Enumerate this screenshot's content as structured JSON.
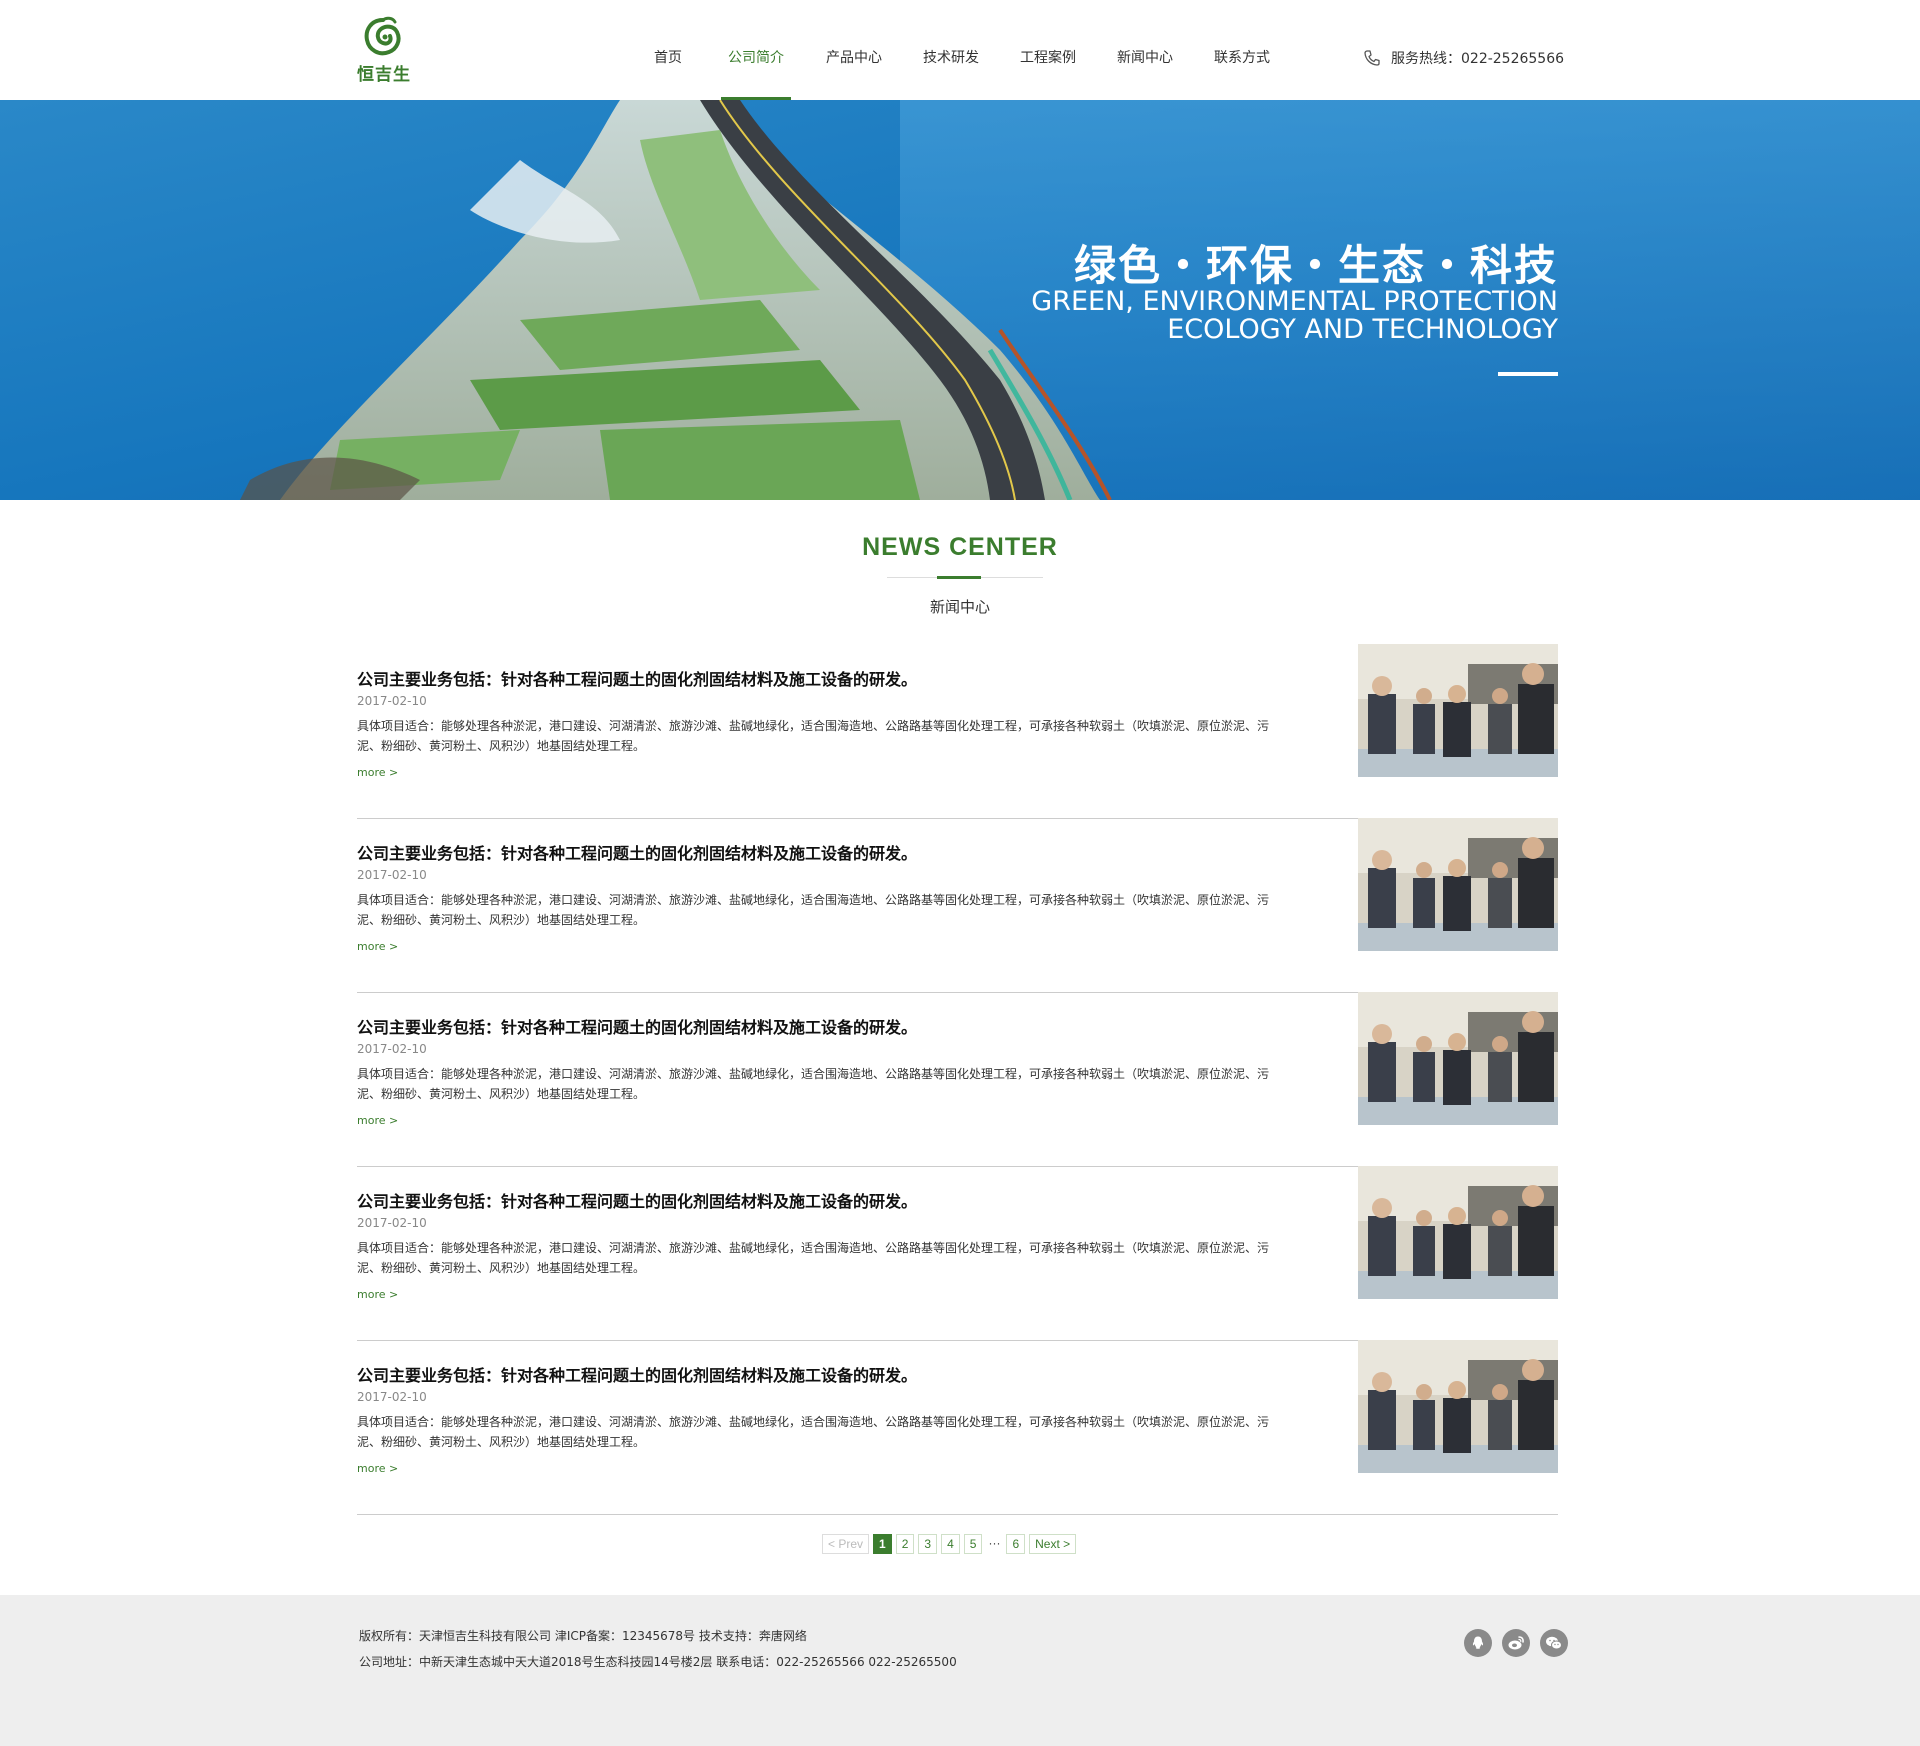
{
  "header": {
    "logo_text": "恒吉生",
    "nav": [
      "首页",
      "公司简介",
      "产品中心",
      "技术研发",
      "工程案例",
      "新闻中心",
      "联系方式"
    ],
    "active_nav": "公司简介",
    "hotline": "服务热线：022-25265566"
  },
  "banner": {
    "title": "绿色・环保・生态・科技",
    "subtitle_line1": "GREEN, ENVIRONMENTAL PROTECTION",
    "subtitle_line2": "ECOLOGY AND TECHNOLOGY"
  },
  "section": {
    "title": "NEWS CENTER",
    "subtitle": "新闻中心"
  },
  "news": [
    {
      "title": "公司主要业务包括：针对各种工程问题土的固化剂固结材料及施工设备的研发。",
      "date": "2017-02-10",
      "desc": "具体项目适合：能够处理各种淤泥，港口建设、河湖清淤、旅游沙滩、盐碱地绿化，适合围海造地、公路路基等固化处理工程，可承接各种软弱土（吹填淤泥、原位淤泥、污泥、粉细砂、黄河粉土、风积沙）地基固结处理工程。",
      "more": "more >"
    },
    {
      "title": "公司主要业务包括：针对各种工程问题土的固化剂固结材料及施工设备的研发。",
      "date": "2017-02-10",
      "desc": "具体项目适合：能够处理各种淤泥，港口建设、河湖清淤、旅游沙滩、盐碱地绿化，适合围海造地、公路路基等固化处理工程，可承接各种软弱土（吹填淤泥、原位淤泥、污泥、粉细砂、黄河粉土、风积沙）地基固结处理工程。",
      "more": "more >"
    },
    {
      "title": "公司主要业务包括：针对各种工程问题土的固化剂固结材料及施工设备的研发。",
      "date": "2017-02-10",
      "desc": "具体项目适合：能够处理各种淤泥，港口建设、河湖清淤、旅游沙滩、盐碱地绿化，适合围海造地、公路路基等固化处理工程，可承接各种软弱土（吹填淤泥、原位淤泥、污泥、粉细砂、黄河粉土、风积沙）地基固结处理工程。",
      "more": "more >"
    },
    {
      "title": "公司主要业务包括：针对各种工程问题土的固化剂固结材料及施工设备的研发。",
      "date": "2017-02-10",
      "desc": "具体项目适合：能够处理各种淤泥，港口建设、河湖清淤、旅游沙滩、盐碱地绿化，适合围海造地、公路路基等固化处理工程，可承接各种软弱土（吹填淤泥、原位淤泥、污泥、粉细砂、黄河粉土、风积沙）地基固结处理工程。",
      "more": "more >"
    },
    {
      "title": "公司主要业务包括：针对各种工程问题土的固化剂固结材料及施工设备的研发。",
      "date": "2017-02-10",
      "desc": "具体项目适合：能够处理各种淤泥，港口建设、河湖清淤、旅游沙滩、盐碱地绿化，适合围海造地、公路路基等固化处理工程，可承接各种软弱土（吹填淤泥、原位淤泥、污泥、粉细砂、黄河粉土、风积沙）地基固结处理工程。",
      "more": "more >"
    }
  ],
  "pagination": {
    "prev": "< Prev",
    "pages": [
      "1",
      "2",
      "3",
      "4",
      "5"
    ],
    "ellipsis": "···",
    "last": "6",
    "next": "Next >",
    "current": "1"
  },
  "footer": {
    "line1": "版权所有：天津恒吉生科技有限公司 津ICP备案：12345678号 技术支持：奔唐网络",
    "line2": "公司地址：中新天津生态城中天大道2018号生态科技园14号楼2层  联系电话：022-25265566  022-25265500",
    "social": [
      "qq-icon",
      "weibo-icon",
      "wechat-icon"
    ]
  },
  "colors": {
    "brand_green": "#3b7d2e",
    "footer_bg": "#eeeeee"
  }
}
